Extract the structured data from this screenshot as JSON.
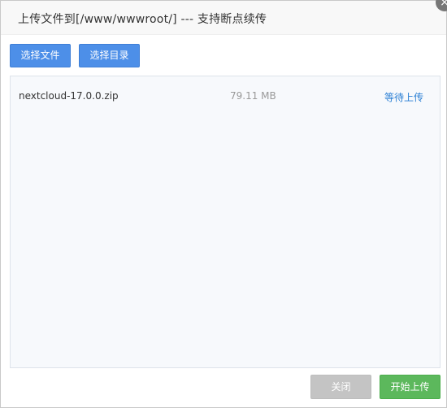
{
  "dialog": {
    "title": "上传文件到[/www/wwwroot/] --- 支持断点续传",
    "close_icon": "×"
  },
  "toolbar": {
    "select_file_label": "选择文件",
    "select_dir_label": "选择目录"
  },
  "files": [
    {
      "name": "nextcloud-17.0.0.zip",
      "size": "79.11 MB",
      "status": "等待上传"
    }
  ],
  "footer": {
    "close_label": "关闭",
    "start_label": "开始上传"
  }
}
